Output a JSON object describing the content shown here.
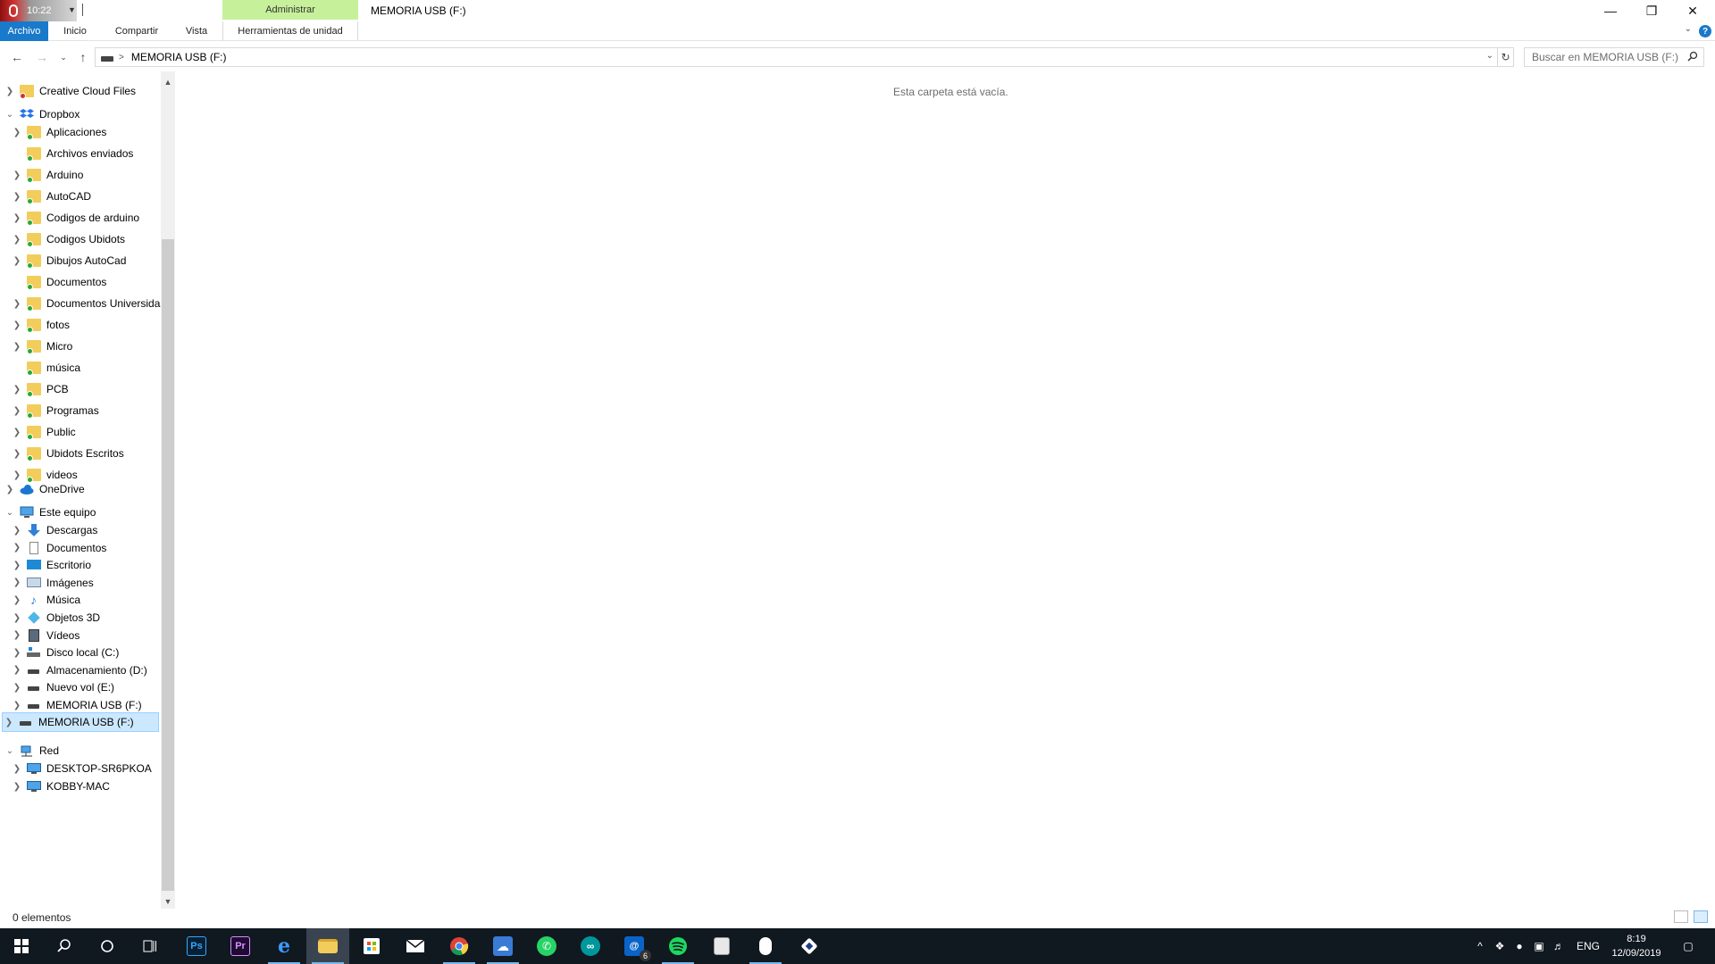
{
  "recorder": {
    "time": "10:22"
  },
  "window": {
    "title": "MEMORIA USB (F:)",
    "context_tab": "Administrar"
  },
  "ribbon": {
    "tabs": [
      "Archivo",
      "Inicio",
      "Compartir",
      "Vista",
      "Herramientas de unidad"
    ],
    "help": "?"
  },
  "address": {
    "path": "MEMORIA USB (F:)",
    "search_placeholder": "Buscar en MEMORIA USB (F:)"
  },
  "nav": {
    "creative_cloud": "Creative Cloud Files",
    "dropbox": "Dropbox",
    "dropbox_items": [
      "Aplicaciones",
      "Archivos enviados",
      "Arduino",
      "AutoCAD",
      "Codigos de arduino",
      "Codigos Ubidots",
      "Dibujos AutoCad",
      "Documentos",
      "Documentos Universida",
      "fotos",
      "Micro",
      "música",
      "PCB",
      "Programas",
      "Public",
      "Ubidots Escritos",
      "videos"
    ],
    "onedrive": "OneDrive",
    "this_pc": "Este equipo",
    "pc_items": [
      "Descargas",
      "Documentos",
      "Escritorio",
      "Imágenes",
      "Música",
      "Objetos 3D",
      "Vídeos",
      "Disco local (C:)",
      "Almacenamiento (D:)",
      "Nuevo vol (E:)",
      "MEMORIA USB (F:)"
    ],
    "usb_selected": "MEMORIA USB (F:)",
    "network": "Red",
    "network_items": [
      "DESKTOP-SR6PKOA",
      "KOBBY-MAC"
    ]
  },
  "content": {
    "empty_message": "Esta carpeta está vacía."
  },
  "status": {
    "items": "0 elementos"
  },
  "taskbar": {
    "apps": [
      "start",
      "search",
      "cortana",
      "task-view",
      "photoshop",
      "premiere",
      "edge",
      "file-explorer",
      "store",
      "mail",
      "chrome",
      "cloud",
      "whatsapp",
      "arduino",
      "outlook",
      "spotify",
      "notepad",
      "voice-recorder",
      "visual-studio"
    ],
    "outlook_badge": "6",
    "language": "ENG",
    "time": "8:19",
    "date": "12/09/2019"
  }
}
